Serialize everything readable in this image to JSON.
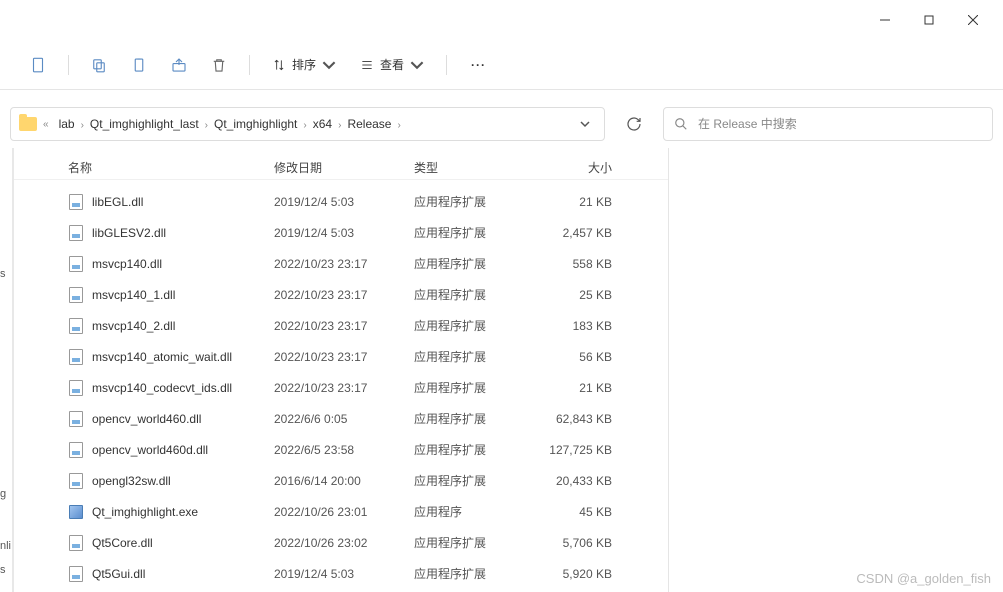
{
  "window": {
    "minimize": "—",
    "maximize": "▢",
    "close": "✕"
  },
  "toolbar": {
    "sort_label": "排序",
    "view_label": "查看"
  },
  "breadcrumb": {
    "sep_first": "«",
    "items": [
      "lab",
      "Qt_imghighlight_last",
      "Qt_imghighlight",
      "x64",
      "Release"
    ]
  },
  "search": {
    "placeholder": "在 Release 中搜索"
  },
  "columns": {
    "name": "名称",
    "date": "修改日期",
    "type": "类型",
    "size": "大小"
  },
  "file_types": {
    "dll": "应用程序扩展",
    "exe": "应用程序"
  },
  "files": [
    {
      "name": "libEGL.dll",
      "date": "2019/12/4 5:03",
      "type": "dll",
      "size": "21 KB"
    },
    {
      "name": "libGLESV2.dll",
      "date": "2019/12/4 5:03",
      "type": "dll",
      "size": "2,457 KB"
    },
    {
      "name": "msvcp140.dll",
      "date": "2022/10/23 23:17",
      "type": "dll",
      "size": "558 KB"
    },
    {
      "name": "msvcp140_1.dll",
      "date": "2022/10/23 23:17",
      "type": "dll",
      "size": "25 KB"
    },
    {
      "name": "msvcp140_2.dll",
      "date": "2022/10/23 23:17",
      "type": "dll",
      "size": "183 KB"
    },
    {
      "name": "msvcp140_atomic_wait.dll",
      "date": "2022/10/23 23:17",
      "type": "dll",
      "size": "56 KB"
    },
    {
      "name": "msvcp140_codecvt_ids.dll",
      "date": "2022/10/23 23:17",
      "type": "dll",
      "size": "21 KB"
    },
    {
      "name": "opencv_world460.dll",
      "date": "2022/6/6 0:05",
      "type": "dll",
      "size": "62,843 KB"
    },
    {
      "name": "opencv_world460d.dll",
      "date": "2022/6/5 23:58",
      "type": "dll",
      "size": "127,725 KB"
    },
    {
      "name": "opengl32sw.dll",
      "date": "2016/6/14 20:00",
      "type": "dll",
      "size": "20,433 KB"
    },
    {
      "name": "Qt_imghighlight.exe",
      "date": "2022/10/26 23:01",
      "type": "exe",
      "size": "45 KB"
    },
    {
      "name": "Qt5Core.dll",
      "date": "2022/10/26 23:02",
      "type": "dll",
      "size": "5,706 KB"
    },
    {
      "name": "Qt5Gui.dll",
      "date": "2019/12/4 5:03",
      "type": "dll",
      "size": "5,920 KB"
    }
  ],
  "left_strip": [
    "s",
    "g",
    "nli",
    "s"
  ],
  "watermark": "CSDN @a_golden_fish"
}
